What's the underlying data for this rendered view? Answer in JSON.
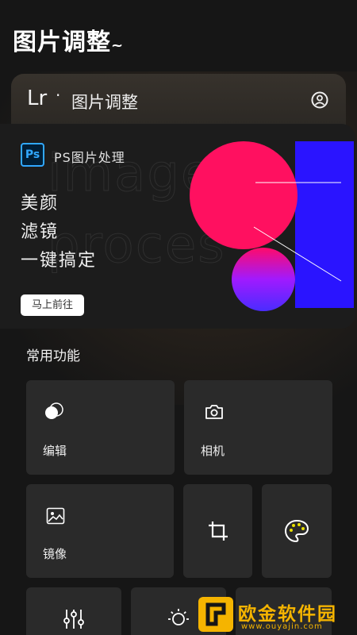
{
  "page": {
    "title": "图片调整"
  },
  "lr_bar": {
    "logo": "Lr",
    "dot": "·",
    "title": "图片调整"
  },
  "ps_card": {
    "app_label": "PS图片处理",
    "logo_text": "Ps",
    "lines": [
      "美颜",
      "滤镜",
      "一键搞定"
    ],
    "button": "马上前往",
    "watermark_1": "image",
    "watermark_2": "proces"
  },
  "features": {
    "section_title": "常用功能",
    "edit_label": "编辑",
    "camera_label": "相机",
    "mirror_label": "镜像"
  },
  "site_watermark": {
    "name": "欧金软件园",
    "url": "www.ouyajin.com"
  },
  "colors": {
    "circle_pink": "#ff1060",
    "rect_blue": "#2a14ff",
    "palette_yellow": "#e8e000",
    "ps_blue": "#31a8ff",
    "watermark_gold": "#f5b400"
  }
}
